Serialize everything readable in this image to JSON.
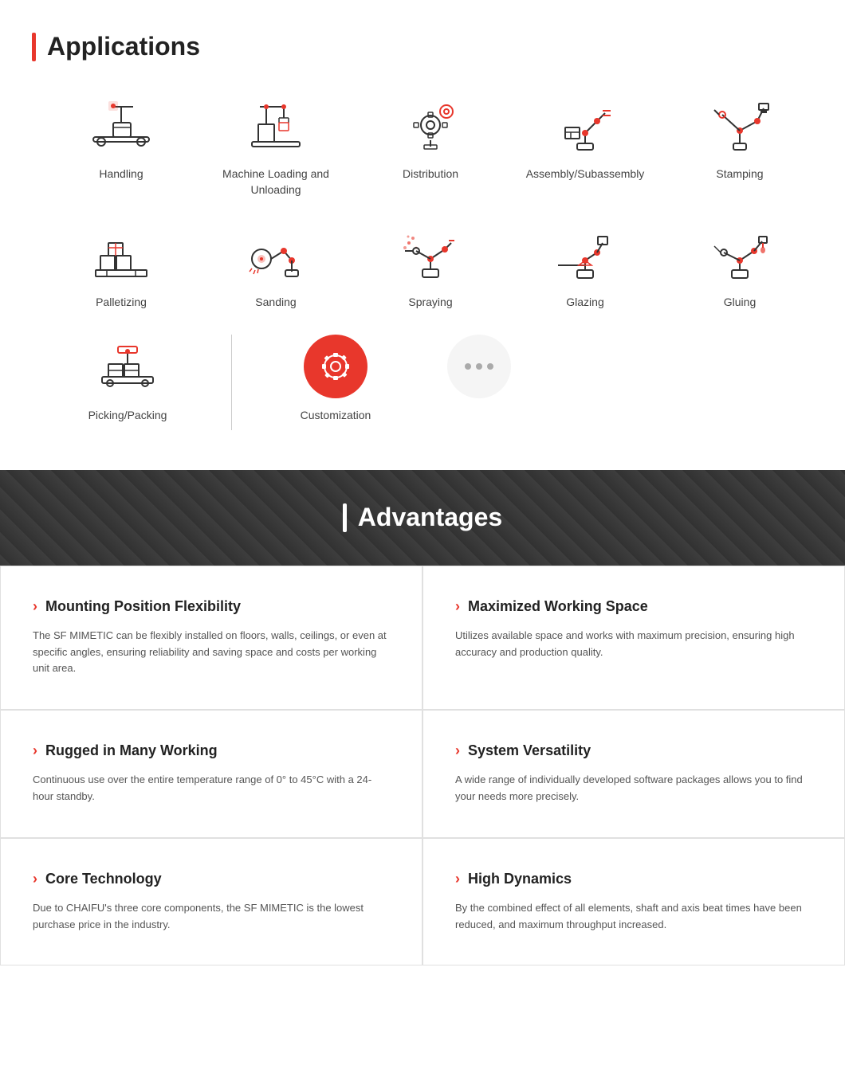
{
  "applications": {
    "section_title": "Applications",
    "title_bar_color": "#e8372c",
    "row1": [
      {
        "label": "Handling",
        "icon": "handling"
      },
      {
        "label": "Machine Loading and Unloading",
        "icon": "machine-loading"
      },
      {
        "label": "Distribution",
        "icon": "distribution"
      },
      {
        "label": "Assembly/Subassembly",
        "icon": "assembly"
      },
      {
        "label": "Stamping",
        "icon": "stamping"
      }
    ],
    "row2": [
      {
        "label": "Palletizing",
        "icon": "palletizing"
      },
      {
        "label": "Sanding",
        "icon": "sanding"
      },
      {
        "label": "Spraying",
        "icon": "spraying"
      },
      {
        "label": "Glazing",
        "icon": "glazing"
      },
      {
        "label": "Gluing",
        "icon": "gluing"
      }
    ],
    "row3_left_label": "Picking/Packing",
    "row3_center_label": "Customization"
  },
  "advantages": {
    "section_title": "Advantages",
    "cards": [
      {
        "title": "Mounting Position Flexibility",
        "body": "The SF MIMETIC can be flexibly installed on floors, walls, ceilings, or even at specific angles, ensuring reliability and saving space and costs per working unit area."
      },
      {
        "title": "Maximized Working Space",
        "body": "Utilizes available space and works with maximum precision, ensuring high accuracy and production quality."
      },
      {
        "title": "Rugged in Many Working",
        "body": "Continuous use over the entire temperature range of 0° to 45°C with a 24-hour standby."
      },
      {
        "title": "System Versatility",
        "body": "A wide range of individually developed software packages allows you to find your needs more precisely."
      },
      {
        "title": "Core Technology",
        "body": "Due to CHAIFU's three core components, the SF MIMETIC is the lowest purchase price in the industry."
      },
      {
        "title": "High Dynamics",
        "body": "By the combined effect of all elements, shaft and axis beat times have been reduced, and maximum throughput increased."
      }
    ]
  }
}
